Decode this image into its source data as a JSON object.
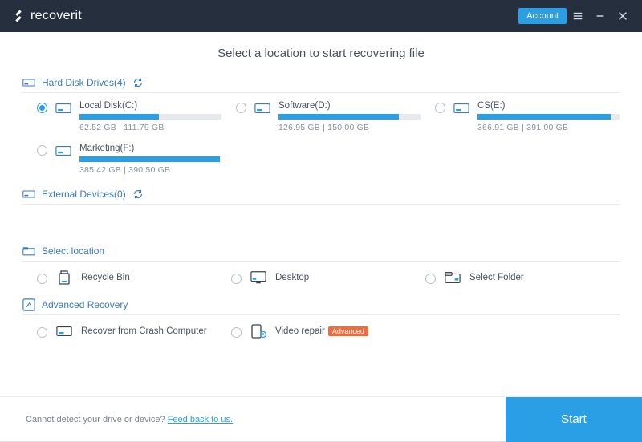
{
  "app": {
    "name": "recoverit"
  },
  "titlebar": {
    "account_label": "Account"
  },
  "heading": "Select a location to start recovering file",
  "sections": {
    "hdd": {
      "title": "Hard Disk Drives(4)"
    },
    "ext": {
      "title": "External Devices(0)"
    },
    "loc": {
      "title": "Select location"
    },
    "adv": {
      "title": "Advanced Recovery"
    }
  },
  "drives": [
    {
      "name": "Local Disk(C:)",
      "used": 62.52,
      "total": 111.79,
      "size_text": "62.52  GB | 111.79  GB",
      "selected": true
    },
    {
      "name": "Software(D:)",
      "used": 126.95,
      "total": 150.0,
      "size_text": "126.95  GB | 150.00  GB",
      "selected": false
    },
    {
      "name": "CS(E:)",
      "used": 366.91,
      "total": 391.0,
      "size_text": "366.91  GB | 391.00  GB",
      "selected": false
    },
    {
      "name": "Marketing(F:)",
      "used": 385.42,
      "total": 390.5,
      "size_text": "385.42  GB | 390.50  GB",
      "selected": false
    }
  ],
  "locations": [
    {
      "name": "Recycle Bin",
      "icon": "recycle"
    },
    {
      "name": "Desktop",
      "icon": "desktop"
    },
    {
      "name": "Select Folder",
      "icon": "folder"
    }
  ],
  "advanced": [
    {
      "name": "Recover from Crash Computer",
      "badge": null
    },
    {
      "name": "Video repair",
      "badge": "Advanced"
    }
  ],
  "footer": {
    "text": "Cannot detect your drive or device? ",
    "link": "Feed back to us.",
    "start": "Start"
  },
  "colors": {
    "accent": "#2b9fe6",
    "header": "#252f3e"
  }
}
